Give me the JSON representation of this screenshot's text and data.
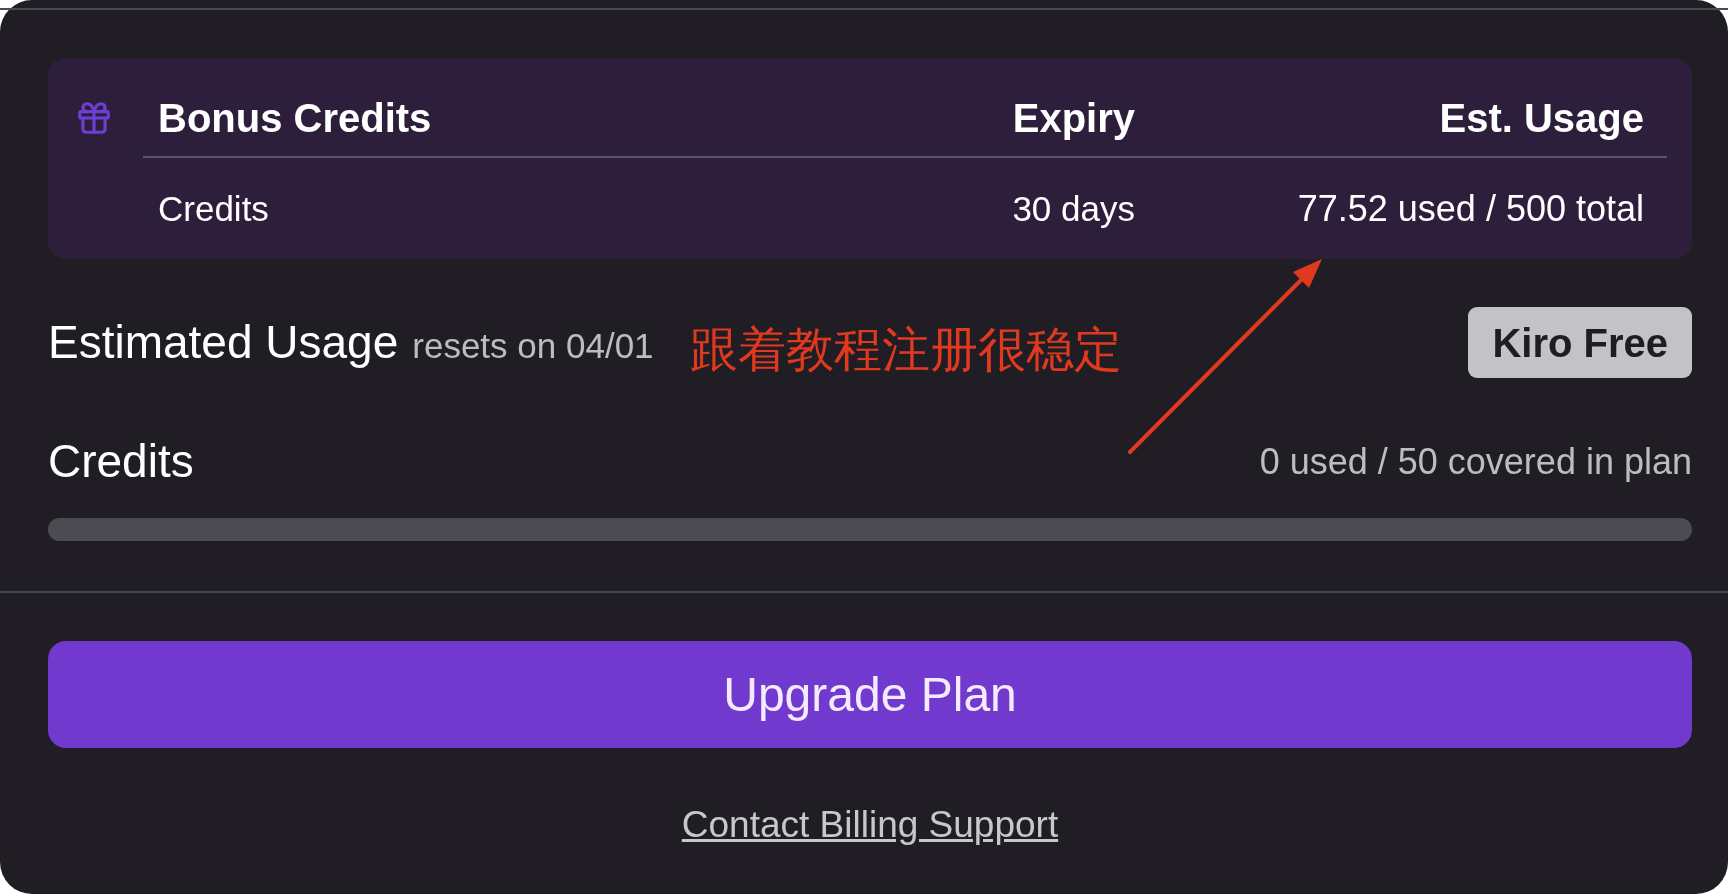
{
  "bonus_credits": {
    "columns": [
      "Bonus Credits",
      "Expiry",
      "Est. Usage"
    ],
    "rows": [
      {
        "name": "Credits",
        "expiry": "30 days",
        "est_usage": "77.52 used / 500 total"
      }
    ]
  },
  "estimated_usage": {
    "title": "Estimated Usage",
    "resets": "resets on 04/01",
    "plan_badge": "Kiro Free"
  },
  "annotation": {
    "text": "跟着教程注册很稳定"
  },
  "credits": {
    "title": "Credits",
    "reading": "0 used / 50 covered in plan"
  },
  "upgrade_button": "Upgrade Plan",
  "billing_support_link": "Contact Billing Support"
}
